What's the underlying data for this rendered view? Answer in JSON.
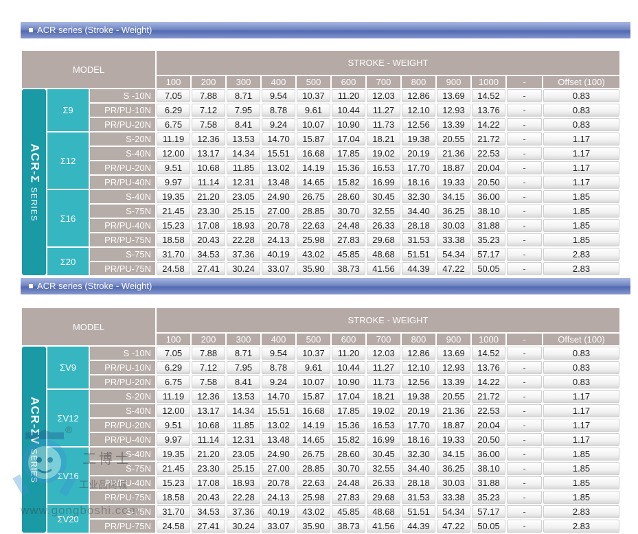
{
  "section1": {
    "title": "ACR series (Stroke - Weight)",
    "series_name": "ACR-Σ",
    "series_suffix": "SERIES"
  },
  "section2": {
    "title": "ACR series (Stroke - Weight)",
    "series_name": "ACR-ΣV",
    "series_suffix": "SERIES"
  },
  "header": {
    "model_label": "MODEL",
    "stroke_weight_label": "STROKE - WEIGHT",
    "strokes": [
      "100",
      "200",
      "300",
      "400",
      "500",
      "600",
      "700",
      "800",
      "900",
      "1000",
      "-",
      "Offset (100)"
    ]
  },
  "table1_groups": [
    {
      "name": "Σ9",
      "rows": [
        {
          "variant": "S -10N",
          "values": [
            "7.05",
            "7.88",
            "8.71",
            "9.54",
            "10.37",
            "11.20",
            "12.03",
            "12.86",
            "13.69",
            "14.52"
          ],
          "dash": "-",
          "offset": "0.83"
        },
        {
          "variant": "PR/PU-10N",
          "values": [
            "6.29",
            "7.12",
            "7.95",
            "8.78",
            "9.61",
            "10.44",
            "11.27",
            "12.10",
            "12.93",
            "13.76"
          ],
          "dash": "-",
          "offset": "0.83"
        },
        {
          "variant": "PR/PU-20N",
          "values": [
            "6.75",
            "7.58",
            "8.41",
            "9.24",
            "10.07",
            "10.90",
            "11.73",
            "12.56",
            "13.39",
            "14.22"
          ],
          "dash": "-",
          "offset": "0.83"
        }
      ]
    },
    {
      "name": "Σ12",
      "rows": [
        {
          "variant": "S-20N",
          "values": [
            "11.19",
            "12.36",
            "13.53",
            "14.70",
            "15.87",
            "17.04",
            "18.21",
            "19.38",
            "20.55",
            "21.72"
          ],
          "dash": "-",
          "offset": "1.17"
        },
        {
          "variant": "S-40N",
          "values": [
            "12.00",
            "13.17",
            "14.34",
            "15.51",
            "16.68",
            "17.85",
            "19.02",
            "20.19",
            "21.36",
            "22.53"
          ],
          "dash": "-",
          "offset": "1.17"
        },
        {
          "variant": "PR/PU-20N",
          "values": [
            "9.51",
            "10.68",
            "11.85",
            "13.02",
            "14.19",
            "15.36",
            "16.53",
            "17.70",
            "18.87",
            "20.04"
          ],
          "dash": "-",
          "offset": "1.17"
        },
        {
          "variant": "PR/PU-40N",
          "values": [
            "9.97",
            "11.14",
            "12.31",
            "13.48",
            "14.65",
            "15.82",
            "16.99",
            "18.16",
            "19.33",
            "20.50"
          ],
          "dash": "-",
          "offset": "1.17"
        }
      ]
    },
    {
      "name": "Σ16",
      "rows": [
        {
          "variant": "S-40N",
          "values": [
            "19.35",
            "21.20",
            "23.05",
            "24.90",
            "26.75",
            "28.60",
            "30.45",
            "32.30",
            "34.15",
            "36.00"
          ],
          "dash": "-",
          "offset": "1.85"
        },
        {
          "variant": "S-75N",
          "values": [
            "21.45",
            "23.30",
            "25.15",
            "27.00",
            "28.85",
            "30.70",
            "32.55",
            "34.40",
            "36.25",
            "38.10"
          ],
          "dash": "-",
          "offset": "1.85"
        },
        {
          "variant": "PR/PU-40N",
          "values": [
            "15.23",
            "17.08",
            "18.93",
            "20.78",
            "22.63",
            "24.48",
            "26.33",
            "28.18",
            "30.03",
            "31.88"
          ],
          "dash": "-",
          "offset": "1.85"
        },
        {
          "variant": "PR/PU-75N",
          "values": [
            "18.58",
            "20.43",
            "22.28",
            "24.13",
            "25.98",
            "27.83",
            "29.68",
            "31.53",
            "33.38",
            "35.23"
          ],
          "dash": "-",
          "offset": "1.85"
        }
      ]
    },
    {
      "name": "Σ20",
      "rows": [
        {
          "variant": "S-75N",
          "values": [
            "31.70",
            "34.53",
            "37.36",
            "40.19",
            "43.02",
            "45.85",
            "48.68",
            "51.51",
            "54.34",
            "57.17"
          ],
          "dash": "-",
          "offset": "2.83"
        },
        {
          "variant": "PR/PU-75N",
          "values": [
            "24.58",
            "27.41",
            "30.24",
            "33.07",
            "35.90",
            "38.73",
            "41.56",
            "44.39",
            "47.22",
            "50.05"
          ],
          "dash": "-",
          "offset": "2.83"
        }
      ]
    }
  ],
  "table2_groups": [
    {
      "name": "ΣV9",
      "rows": [
        {
          "variant": "S -10N",
          "values": [
            "7.05",
            "7.88",
            "8.71",
            "9.54",
            "10.37",
            "11.20",
            "12.03",
            "12.86",
            "13.69",
            "14.52"
          ],
          "dash": "-",
          "offset": "0.83"
        },
        {
          "variant": "PR/PU-10N",
          "values": [
            "6.29",
            "7.12",
            "7.95",
            "8.78",
            "9.61",
            "10.44",
            "11.27",
            "12.10",
            "12.93",
            "13.76"
          ],
          "dash": "-",
          "offset": "0.83"
        },
        {
          "variant": "PR/PU-20N",
          "values": [
            "6.75",
            "7.58",
            "8.41",
            "9.24",
            "10.07",
            "10.90",
            "11.73",
            "12.56",
            "13.39",
            "14.22"
          ],
          "dash": "-",
          "offset": "0.83"
        }
      ]
    },
    {
      "name": "ΣV12",
      "rows": [
        {
          "variant": "S-20N",
          "values": [
            "11.19",
            "12.36",
            "13.53",
            "14.70",
            "15.87",
            "17.04",
            "18.21",
            "19.38",
            "20.55",
            "21.72"
          ],
          "dash": "-",
          "offset": "1.17"
        },
        {
          "variant": "S-40N",
          "values": [
            "12.00",
            "13.17",
            "14.34",
            "15.51",
            "16.68",
            "17.85",
            "19.02",
            "20.19",
            "21.36",
            "22.53"
          ],
          "dash": "-",
          "offset": "1.17"
        },
        {
          "variant": "PR/PU-20N",
          "values": [
            "9.51",
            "10.68",
            "11.85",
            "13.02",
            "14.19",
            "15.36",
            "16.53",
            "17.70",
            "18.87",
            "20.04"
          ],
          "dash": "-",
          "offset": "1.17"
        },
        {
          "variant": "PR/PU-40N",
          "values": [
            "9.97",
            "11.14",
            "12.31",
            "13.48",
            "14.65",
            "15.82",
            "16.99",
            "18.16",
            "19.33",
            "20.50"
          ],
          "dash": "-",
          "offset": "1.17"
        }
      ]
    },
    {
      "name": "ΣV16",
      "rows": [
        {
          "variant": "S-40N",
          "values": [
            "19.35",
            "21.20",
            "23.05",
            "24.90",
            "26.75",
            "28.60",
            "30.45",
            "32.30",
            "34.15",
            "36.00"
          ],
          "dash": "-",
          "offset": "1.85"
        },
        {
          "variant": "S-75N",
          "values": [
            "21.45",
            "23.30",
            "25.15",
            "27.00",
            "28.85",
            "30.70",
            "32.55",
            "34.40",
            "36.25",
            "38.10"
          ],
          "dash": "-",
          "offset": "1.85"
        },
        {
          "variant": "PR/PU-40N",
          "values": [
            "15.23",
            "17.08",
            "18.93",
            "20.78",
            "22.63",
            "24.48",
            "26.33",
            "28.18",
            "30.03",
            "31.88"
          ],
          "dash": "-",
          "offset": "1.85"
        },
        {
          "variant": "PR/PU-75N",
          "values": [
            "18.58",
            "20.43",
            "22.28",
            "24.13",
            "25.98",
            "27.83",
            "29.68",
            "31.53",
            "33.38",
            "35.23"
          ],
          "dash": "-",
          "offset": "1.85"
        }
      ]
    },
    {
      "name": "ΣV20",
      "rows": [
        {
          "variant": "S-75N",
          "values": [
            "31.70",
            "34.53",
            "37.36",
            "40.19",
            "43.02",
            "45.85",
            "48.68",
            "51.51",
            "54.34",
            "57.17"
          ],
          "dash": "-",
          "offset": "2.83"
        },
        {
          "variant": "PR/PU-75N",
          "values": [
            "24.58",
            "27.41",
            "30.24",
            "33.07",
            "35.90",
            "38.73",
            "41.56",
            "44.39",
            "47.22",
            "50.05"
          ],
          "dash": "-",
          "offset": "2.83"
        }
      ]
    }
  ],
  "watermark": {
    "brand_cn": "工博士",
    "registered": "®",
    "shop_cn": "工业品商城",
    "url": "www.gongboshi.com"
  },
  "colors": {
    "header_bar": "#5269b0",
    "series_teal": "#1a9aa5",
    "group_teal": "#35b6c1",
    "header_taupe": "#b5aaa6"
  }
}
